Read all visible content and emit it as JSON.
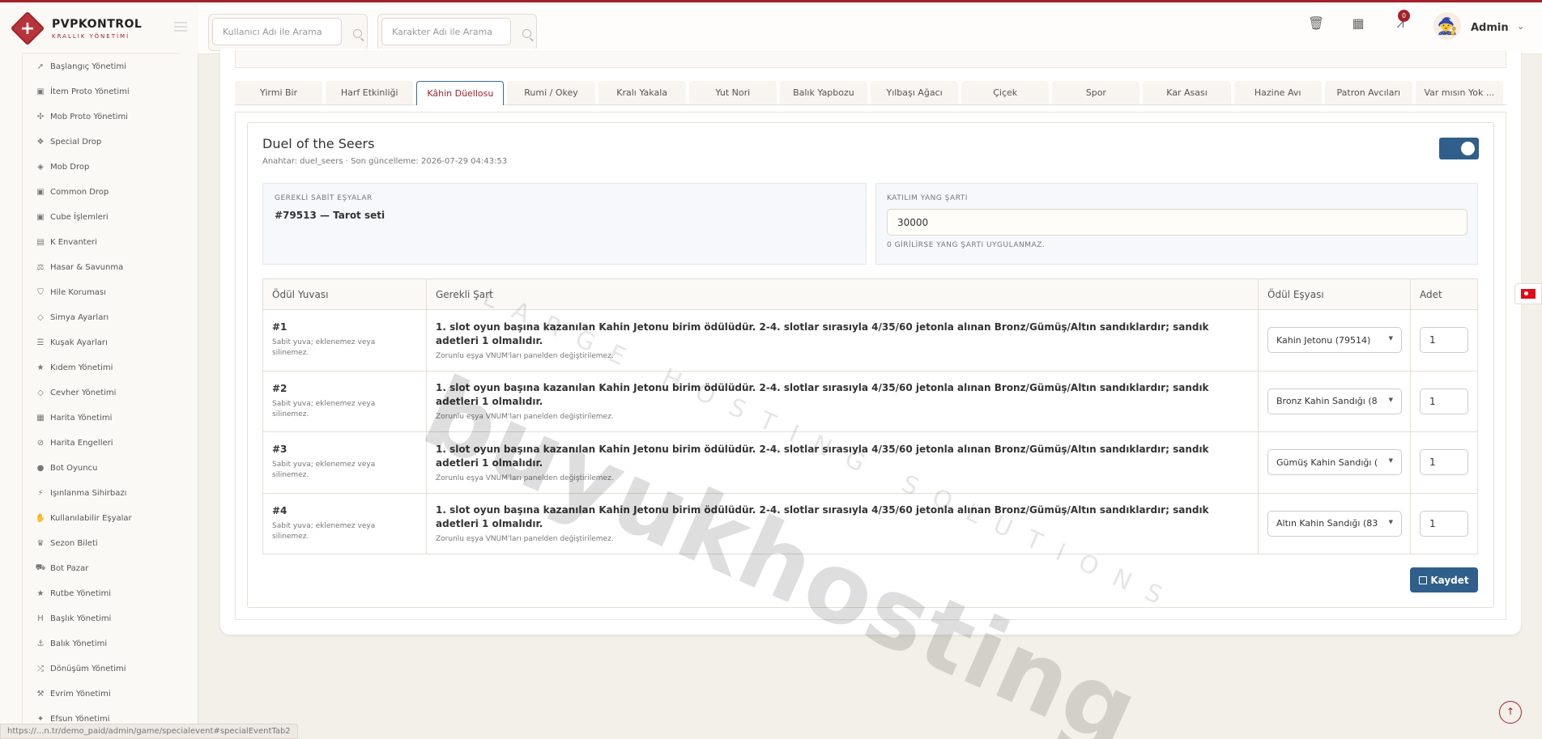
{
  "brand": {
    "title": "PVPKONTROL",
    "subtitle": "KRALLIK YÖNETİMİ"
  },
  "sidebar": {
    "items": [
      {
        "label": "Başlangıç Yönetimi",
        "icon": "rocket-icon",
        "glyph": "➚"
      },
      {
        "label": "İtem Proto Yönetimi",
        "icon": "box-icon",
        "glyph": "▣"
      },
      {
        "label": "Mob Proto Yönetimi",
        "icon": "paw-icon",
        "glyph": "✣"
      },
      {
        "label": "Special Drop",
        "icon": "gift-icon",
        "glyph": "❖"
      },
      {
        "label": "Mob Drop",
        "icon": "bag-icon",
        "glyph": "◈"
      },
      {
        "label": "Common Drop",
        "icon": "box-icon",
        "glyph": "▣"
      },
      {
        "label": "Cube İşlemleri",
        "icon": "cube-icon",
        "glyph": "▣"
      },
      {
        "label": "K Envanteri",
        "icon": "inventory-icon",
        "glyph": "▤"
      },
      {
        "label": "Hasar & Savunma",
        "icon": "scale-icon",
        "glyph": "⚖"
      },
      {
        "label": "Hile Koruması",
        "icon": "shield-icon",
        "glyph": "⛉"
      },
      {
        "label": "Simya Ayarları",
        "icon": "gem-icon",
        "glyph": "◇"
      },
      {
        "label": "Kuşak Ayarları",
        "icon": "sliders-icon",
        "glyph": "☰"
      },
      {
        "label": "Kıdem Yönetimi",
        "icon": "star-icon",
        "glyph": "★"
      },
      {
        "label": "Cevher Yönetimi",
        "icon": "gem-icon",
        "glyph": "◇"
      },
      {
        "label": "Harita Yönetimi",
        "icon": "map-icon",
        "glyph": "▦"
      },
      {
        "label": "Harita Engelleri",
        "icon": "ban-icon",
        "glyph": "⊘"
      },
      {
        "label": "Bot Oyuncu",
        "icon": "user-icon",
        "glyph": "●"
      },
      {
        "label": "Işınlanma Sihirbazı",
        "icon": "wand-icon",
        "glyph": "⚡"
      },
      {
        "label": "Kullanılabilir Eşyalar",
        "icon": "hand-icon",
        "glyph": "✋"
      },
      {
        "label": "Sezon Bileti",
        "icon": "trophy-icon",
        "glyph": "♛"
      },
      {
        "label": "Bot Pazar",
        "icon": "cart-icon",
        "glyph": "⛟"
      },
      {
        "label": "Rutbe Yönetimi",
        "icon": "star-icon",
        "glyph": "★"
      },
      {
        "label": "Başlık Yönetimi",
        "icon": "heading-icon",
        "glyph": "H"
      },
      {
        "label": "Balık Yönetimi",
        "icon": "anchor-icon",
        "glyph": "⚓"
      },
      {
        "label": "Dönüşüm Yönetimi",
        "icon": "shuffle-icon",
        "glyph": "⤮"
      },
      {
        "label": "Evrim Yönetimi",
        "icon": "wand-icon",
        "glyph": "⚒"
      },
      {
        "label": "Efsun Yönetimi",
        "icon": "magic-icon",
        "glyph": "✦"
      }
    ]
  },
  "header": {
    "search_user_placeholder": "Kullanıcı Adı ile Arama",
    "search_char_placeholder": "Karakter Adı ile Arama",
    "notification_count": "0",
    "admin_name": "Admin"
  },
  "tabs": [
    {
      "label": "Yirmi Bir"
    },
    {
      "label": "Harf Etkinliği"
    },
    {
      "label": "Kâhin Düellosu"
    },
    {
      "label": "Rumi / Okey"
    },
    {
      "label": "Kralı Yakala"
    },
    {
      "label": "Yut Nori"
    },
    {
      "label": "Balık Yapbozu"
    },
    {
      "label": "Yılbaşı Ağacı"
    },
    {
      "label": "Çiçek"
    },
    {
      "label": "Spor"
    },
    {
      "label": "Kar Asası"
    },
    {
      "label": "Hazine Avı"
    },
    {
      "label": "Patron Avcıları"
    },
    {
      "label": "Var mısın Yok ..."
    }
  ],
  "event": {
    "title": "Duel of the Seers",
    "meta": "Anahtar: duel_seers · Son güncelleme: 2026-07-29 04:43:53",
    "enabled": true,
    "required_items_label": "GEREKLİ SABİT EŞYALAR",
    "required_items_value": "#79513 — Tarot seti",
    "yang_label": "KATILIM YANG ŞARTI",
    "yang_value": "30000",
    "yang_help": "0 GİRİLİRSE YANG ŞARTI UYGULANMAZ."
  },
  "table": {
    "headers": [
      "Ödül Yuvası",
      "Gerekli Şart",
      "Ödül Eşyası",
      "Adet"
    ],
    "rows": [
      {
        "slot": "#1",
        "slot_note": "Sabit yuva; eklenemez veya silinemez.",
        "condition": "1. slot oyun başına kazanılan Kahin Jetonu birim ödülüdür. 2-4. slotlar sırasıyla 4/35/60 jetonla alınan Bronz/Gümüş/Altın sandıklardır; sandık adetleri 1 olmalıdır.",
        "condition_note": "Zorunlu eşya VNUM'ları panelden değiştirilemez.",
        "item": "Kahin Jetonu (79514)",
        "qty": "1"
      },
      {
        "slot": "#2",
        "slot_note": "Sabit yuva; eklenemez veya silinemez.",
        "condition": "1. slot oyun başına kazanılan Kahin Jetonu birim ödülüdür. 2-4. slotlar sırasıyla 4/35/60 jetonla alınan Bronz/Gümüş/Altın sandıklardır; sandık adetleri 1 olmalıdır.",
        "condition_note": "Zorunlu eşya VNUM'ları panelden değiştirilemez.",
        "item": "Bronz Kahin Sandığı (8",
        "qty": "1"
      },
      {
        "slot": "#3",
        "slot_note": "Sabit yuva; eklenemez veya silinemez.",
        "condition": "1. slot oyun başına kazanılan Kahin Jetonu birim ödülüdür. 2-4. slotlar sırasıyla 4/35/60 jetonla alınan Bronz/Gümüş/Altın sandıklardır; sandık adetleri 1 olmalıdır.",
        "condition_note": "Zorunlu eşya VNUM'ları panelden değiştirilemez.",
        "item": "Gümüş Kahin Sandığı (",
        "qty": "1"
      },
      {
        "slot": "#4",
        "slot_note": "Sabit yuva; eklenemez veya silinemez.",
        "condition": "1. slot oyun başına kazanılan Kahin Jetonu birim ödülüdür. 2-4. slotlar sırasıyla 4/35/60 jetonla alınan Bronz/Gümüş/Altın sandıklardır; sandık adetleri 1 olmalıdır.",
        "condition_note": "Zorunlu eşya VNUM'ları panelden değiştirilemez.",
        "item": "Altın Kahin Sandığı (83",
        "qty": "1"
      }
    ]
  },
  "save_label": "Kaydet",
  "watermark": {
    "main": "buyukhosting",
    "sub": "LARGE HOSTING SOLUTIONS"
  },
  "status_url": "https://...n.tr/demo_paid/admin/game/specialevent#specialEventTab2",
  "colors": {
    "accent": "#a3212a",
    "primary": "#2f5f8a"
  }
}
